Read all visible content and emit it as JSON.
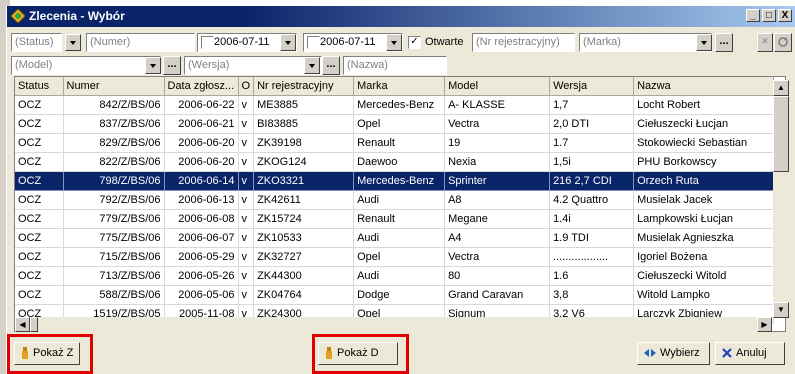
{
  "window": {
    "title": "Zlecenia - Wybór",
    "min": "_",
    "restore": "□",
    "close": "X"
  },
  "filters": {
    "status": "(Status)",
    "numer": "(Numer)",
    "date_from": "2006-07-11",
    "date_to": "2006-07-11",
    "otwarte_label": "Otwarte",
    "nr_rej": "(Nr rejestracyjny)",
    "marka": "(Marka)",
    "model": "(Model)",
    "wersja": "(Wersja)",
    "nazwa": "(Nazwa)",
    "dots": "..."
  },
  "columns": [
    "Status",
    "Numer",
    "Data zgłosz...",
    "O",
    "Nr rejestracyjny",
    "Marka",
    "Model",
    "Wersja",
    "Nazwa"
  ],
  "rows": [
    [
      "OCZ",
      "842/Z/BS/06",
      "2006-06-22",
      "v",
      "ME3885",
      "Mercedes-Benz",
      "A- KLASSE",
      "1,7",
      "Locht Robert"
    ],
    [
      "OCZ",
      "837/Z/BS/06",
      "2006-06-21",
      "v",
      "BI83885",
      "Opel",
      "Vectra",
      "2,0 DTI",
      "Ciełuszecki Łucjan"
    ],
    [
      "OCZ",
      "829/Z/BS/06",
      "2006-06-20",
      "v",
      "ZK39198",
      "Renault",
      "19",
      "1.7",
      "Stokowiecki Sebastian"
    ],
    [
      "OCZ",
      "822/Z/BS/06",
      "2006-06-20",
      "v",
      "ZKOG124",
      "Daewoo",
      "Nexia",
      "1,5i",
      "PHU Borkowscy"
    ],
    [
      "OCZ",
      "798/Z/BS/06",
      "2006-06-14",
      "v",
      "ZKO3321",
      "Mercedes-Benz",
      "Sprinter",
      "216 2,7 CDI",
      "Orzech Ruta"
    ],
    [
      "OCZ",
      "792/Z/BS/06",
      "2006-06-13",
      "v",
      "ZK42611",
      "Audi",
      "A8",
      "4.2 Quattro",
      "Musielak Jacek"
    ],
    [
      "OCZ",
      "779/Z/BS/06",
      "2006-06-08",
      "v",
      "ZK15724",
      "Renault",
      "Megane",
      "1.4i",
      "Lampkowski Łucjan"
    ],
    [
      "OCZ",
      "775/Z/BS/06",
      "2006-06-07",
      "v",
      "ZK10533",
      "Audi",
      "A4",
      "1.9 TDI",
      "Musielak Agnieszka"
    ],
    [
      "OCZ",
      "715/Z/BS/06",
      "2006-05-29",
      "v",
      "ZK32727",
      "Opel",
      "Vectra",
      "..................",
      "Igoriel Bożena"
    ],
    [
      "OCZ",
      "713/Z/BS/06",
      "2006-05-26",
      "v",
      "ZK44300",
      "Audi",
      "80",
      "1.6",
      "Ciełuszecki Witold"
    ],
    [
      "OCZ",
      "588/Z/BS/06",
      "2006-05-06",
      "v",
      "ZK04764",
      "Dodge",
      "Grand Caravan",
      "3,8",
      "Witold Lampko"
    ],
    [
      "OCZ",
      "1519/Z/BS/05",
      "2005-11-08",
      "v",
      "ZK24300",
      "Opel",
      "Signum",
      "3.2 V6",
      "Larczyk Zbigniew"
    ]
  ],
  "selected_row": 4,
  "buttons": {
    "pokaz_z": "Pokaż Z",
    "pokaz_d": "Pokaż D",
    "wybierz": "Wybierz",
    "anuluj": "Anuluj"
  }
}
